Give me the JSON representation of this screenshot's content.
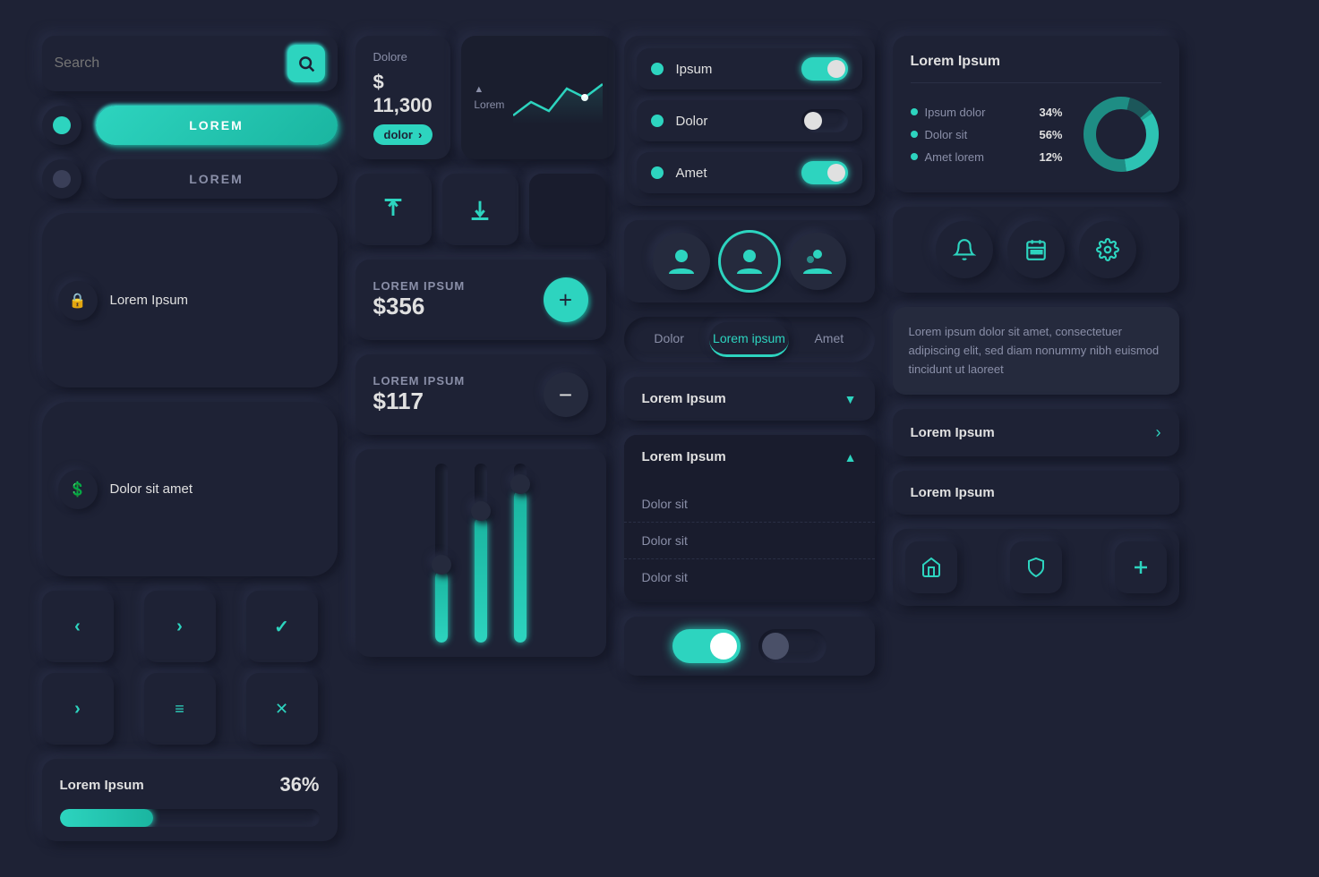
{
  "search": {
    "placeholder": "Search",
    "icon": "🔍"
  },
  "buttons": {
    "primary_label": "LOREM",
    "secondary_label": "LOREM"
  },
  "list_buttons": [
    {
      "icon": "🔒",
      "label": "Lorem Ipsum"
    },
    {
      "icon": "💲",
      "label": "Dolor sit amet"
    }
  ],
  "icon_grid": [
    {
      "icon": "<",
      "label": "left"
    },
    {
      "icon": ">",
      "label": "right"
    },
    {
      "icon": "✓",
      "label": "check"
    },
    {
      "icon": ">",
      "label": "chevron"
    },
    {
      "icon": "≡",
      "label": "menu"
    },
    {
      "icon": "✕",
      "label": "close"
    }
  ],
  "progress": {
    "title": "Lorem Ipsum",
    "value": "36%",
    "fill": 36
  },
  "stat": {
    "label": "Dolore",
    "value": "$ 11,300",
    "badge": "dolor"
  },
  "chart": {
    "label": "Lorem"
  },
  "action_buttons": {
    "upload_label": "↑",
    "download_label": "↓"
  },
  "counter1": {
    "label": "LOREM IPSUM",
    "value": "$356",
    "btn": "+"
  },
  "counter2": {
    "label": "LOREM IPSUM",
    "value": "$117",
    "btn": "−"
  },
  "toggle_items": [
    {
      "label": "Ipsum",
      "on": true
    },
    {
      "label": "Dolor",
      "on": false
    },
    {
      "label": "Amet",
      "on": true
    }
  ],
  "tabs": [
    {
      "label": "Dolor",
      "active": false
    },
    {
      "label": "Lorem ipsum",
      "active": true
    },
    {
      "label": "Amet",
      "active": false
    }
  ],
  "dropdown_closed": {
    "label": "Lorem Ipsum"
  },
  "dropdown_open": {
    "label": "Lorem Ipsum",
    "items": [
      "Dolor sit",
      "Dolor sit",
      "Dolor sit"
    ]
  },
  "donut": {
    "title": "Lorem Ipsum",
    "segments": [
      {
        "label": "Ipsum dolor",
        "pct": "34%",
        "color": "#2dd4bf"
      },
      {
        "label": "Dolor sit",
        "pct": "56%",
        "color": "#2dd4bf"
      },
      {
        "label": "Amet lorem",
        "pct": "12%",
        "color": "#2dd4bf"
      }
    ]
  },
  "icon_actions": [
    {
      "icon": "🔔",
      "label": "notification"
    },
    {
      "icon": "📅",
      "label": "calendar"
    },
    {
      "icon": "⚙",
      "label": "settings"
    }
  ],
  "text_card": {
    "content": "Lorem ipsum dolor sit amet, consectetuer adipiscing elit, sed diam nonummy nibh euismod tincidunt ut laoreet"
  },
  "nav_items": [
    {
      "label": "Lorem Ipsum",
      "has_arrow": true
    },
    {
      "label": "Lorem Ipsum",
      "has_arrow": false
    }
  ],
  "bottom_nav": [
    {
      "icon": "🏠",
      "label": "home"
    },
    {
      "icon": "🛡",
      "label": "shield"
    },
    {
      "icon": "+",
      "label": "add"
    }
  ]
}
